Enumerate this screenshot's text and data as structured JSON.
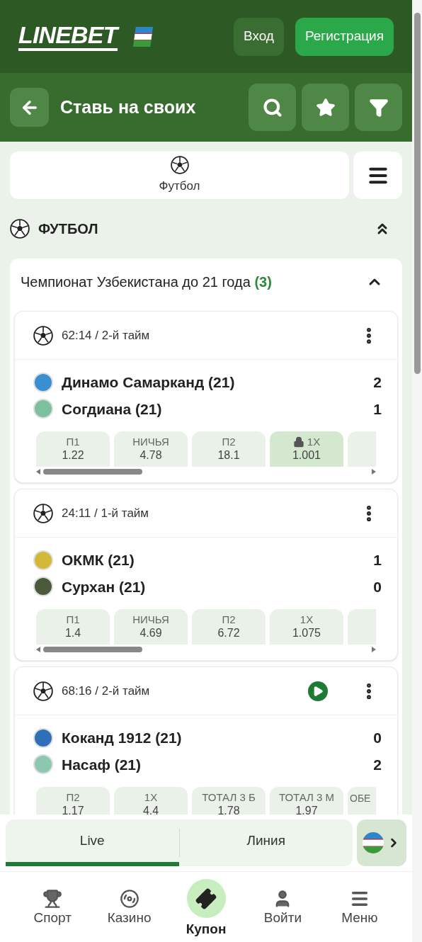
{
  "header": {
    "logo": "LINEBET",
    "login": "Вход",
    "register": "Регистрация"
  },
  "subheader": {
    "title": "Ставь на своих"
  },
  "sport_tabs": [
    {
      "label": "Футбол",
      "selected": true
    }
  ],
  "section": {
    "title": "ФУТБОЛ"
  },
  "league": {
    "name": "Чемпионат Узбекистана до 21 года",
    "count": "(3)",
    "expanded": true
  },
  "matches": [
    {
      "time": "62:14 / 2-й тайм",
      "video": false,
      "teams": [
        {
          "name": "Динамо Самарканд (21)",
          "score": "2",
          "color": "#3a8fd0"
        },
        {
          "name": "Согдиана (21)",
          "score": "1",
          "color": "#7cc0a0"
        }
      ],
      "odds": [
        {
          "label": "П1",
          "value": "1.22",
          "locked": false
        },
        {
          "label": "НИЧЬЯ",
          "value": "4.78",
          "locked": false
        },
        {
          "label": "П2",
          "value": "18.1",
          "locked": false
        },
        {
          "label": "1X",
          "value": "1.001",
          "locked": true
        }
      ]
    },
    {
      "time": "24:11 / 1-й тайм",
      "video": false,
      "teams": [
        {
          "name": "ОКМК (21)",
          "score": "1",
          "color": "#d4b83a"
        },
        {
          "name": "Сурхан (21)",
          "score": "0",
          "color": "#4a5a3a"
        }
      ],
      "odds": [
        {
          "label": "П1",
          "value": "1.4",
          "locked": false
        },
        {
          "label": "НИЧЬЯ",
          "value": "4.69",
          "locked": false
        },
        {
          "label": "П2",
          "value": "6.72",
          "locked": false
        },
        {
          "label": "1X",
          "value": "1.075",
          "locked": false
        }
      ]
    },
    {
      "time": "68:16 / 2-й тайм",
      "video": true,
      "teams": [
        {
          "name": "Коканд 1912 (21)",
          "score": "0",
          "color": "#2f6fb8"
        },
        {
          "name": "Насаф (21)",
          "score": "2",
          "color": "#8cc8b0"
        }
      ],
      "odds": [
        {
          "label": "П2",
          "value": "1.17",
          "locked": false
        },
        {
          "label": "1X",
          "value": "4.4",
          "locked": false
        },
        {
          "label": "ТОТАЛ 3 Б",
          "value": "1.78",
          "locked": false
        },
        {
          "label": "ТОТАЛ 3 М",
          "value": "1.97",
          "locked": false
        }
      ],
      "odds_more": "ОБЕ"
    }
  ],
  "mode_tabs": [
    {
      "label": "Live",
      "selected": true
    },
    {
      "label": "Линия",
      "selected": false
    }
  ],
  "nav": [
    {
      "label": "Спорт",
      "kind": "trophy",
      "selected": false
    },
    {
      "label": "Казино",
      "kind": "chip",
      "selected": false
    },
    {
      "label": "Купон",
      "kind": "ticket",
      "selected": true
    },
    {
      "label": "Войти",
      "kind": "user",
      "selected": false
    },
    {
      "label": "Меню",
      "kind": "menu",
      "selected": false
    }
  ]
}
